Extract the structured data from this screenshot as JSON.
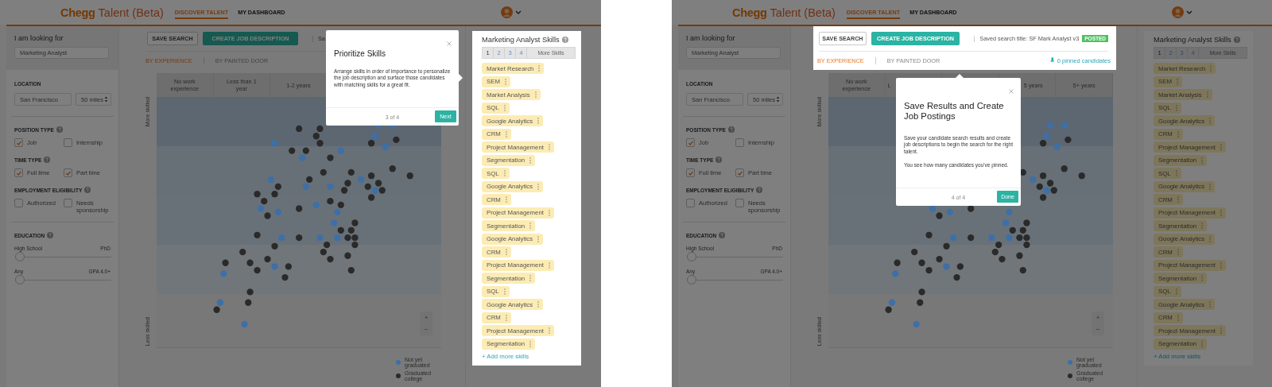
{
  "screens": [
    {
      "header": {
        "brand": "Chegg",
        "product": "Talent (Beta)",
        "nav": [
          {
            "label": "DISCOVER TALENT",
            "selected": true
          },
          {
            "label": "MY DASHBOARD",
            "selected": false
          }
        ]
      },
      "sidebar": {
        "looking_for": {
          "label": "I am looking for",
          "value": "Marketing Analyst"
        },
        "location": {
          "label": "LOCATION",
          "city": "San Francisco",
          "distance": "50 miles"
        },
        "filters": [
          {
            "label": "POSITION TYPE",
            "options": [
              {
                "label": "Job",
                "checked": true
              },
              {
                "label": "Internship",
                "checked": false
              }
            ]
          },
          {
            "label": "TIME TYPE",
            "options": [
              {
                "label": "Full time",
                "checked": true
              },
              {
                "label": "Part time",
                "checked": true
              }
            ]
          },
          {
            "label": "EMPLOYMENT ELIGIBILITY",
            "options": [
              {
                "label": "Authorized",
                "checked": false
              },
              {
                "label": "Needs sponsorship",
                "checked": false
              }
            ]
          }
        ],
        "education": {
          "label": "EDUCATION",
          "sliders": [
            {
              "low": "High School",
              "high": "PhD",
              "level": 0
            },
            {
              "low": "Any",
              "high": "GPA 4.0+",
              "level": 0
            }
          ]
        }
      },
      "toolbar": {
        "highlighted": false,
        "buttons": [
          {
            "label": "SAVE SEARCH",
            "kind": "outline"
          },
          {
            "label": "CREATE JOB DESCRIPTION",
            "kind": "primary"
          }
        ],
        "saved_title": "Sa",
        "views": [
          {
            "label": "BY EXPERIENCE",
            "selected": true
          },
          {
            "label": "BY PAINTED DOOR",
            "selected": false
          }
        ]
      },
      "chart": {
        "columns": [
          {
            "label": "No work experience"
          },
          {
            "label": "Less than 1 year"
          },
          {
            "label": "1-2 years"
          },
          {},
          {}
        ],
        "y_top": "More skilled",
        "y_bottom": "Less skilled",
        "zoom": [
          "+",
          "−"
        ],
        "legend": [
          {
            "label": "Not yet graduated",
            "color": "#3d6fa8"
          },
          {
            "label": "Graduated college",
            "color": "#2a2a2a"
          }
        ]
      },
      "skills": {
        "highlighted": true,
        "title": "Marketing Analyst Skills",
        "tabs": [
          {
            "label": "1",
            "selected": true
          },
          {
            "label": "2",
            "selected": false
          },
          {
            "label": "3",
            "selected": false
          },
          {
            "label": "4",
            "selected": false
          },
          {
            "label": "More Skills",
            "selected": false
          }
        ],
        "items": [
          "Market Research",
          "SEM",
          "Market Analysis",
          "SQL",
          "Google Analytics",
          "CRM",
          "Project Management",
          "Segmentation",
          "SQL",
          "Google Analytics",
          "CRM",
          "Project Management",
          "Segmentation",
          "Google Analytics",
          "CRM",
          "Project Management",
          "Segmentation",
          "SQL",
          "Google Analytics",
          "CRM",
          "Project Management",
          "Segmentation"
        ],
        "add": "+ Add more skills"
      },
      "tour": {
        "title": "Prioritize Skills",
        "body": [
          "Arrange skills in order of importance to personalize the job description and surface those candidates with matching skills for a great fit."
        ],
        "step": "3 of 4",
        "button": "Next"
      }
    },
    {
      "header": {
        "brand": "Chegg",
        "product": "Talent (Beta)",
        "nav": [
          {
            "label": "DISCOVER TALENT",
            "selected": true
          },
          {
            "label": "MY DASHBOARD",
            "selected": false
          }
        ]
      },
      "sidebar": {
        "looking_for": {
          "label": "I am looking for",
          "value": "Marketing Analyst"
        },
        "location": {
          "label": "LOCATION",
          "city": "San Francisco",
          "distance": "50 miles"
        },
        "filters": [
          {
            "label": "POSITION TYPE",
            "options": [
              {
                "label": "Job",
                "checked": true
              },
              {
                "label": "Internship",
                "checked": false
              }
            ]
          },
          {
            "label": "TIME TYPE",
            "options": [
              {
                "label": "Full time",
                "checked": true
              },
              {
                "label": "Part time",
                "checked": true
              }
            ]
          },
          {
            "label": "EMPLOYMENT ELIGIBILITY",
            "options": [
              {
                "label": "Authorized",
                "checked": false
              },
              {
                "label": "Needs sponsorship",
                "checked": false
              }
            ]
          }
        ],
        "education": {
          "label": "EDUCATION",
          "sliders": [
            {
              "low": "High School",
              "high": "PhD",
              "level": 0
            },
            {
              "low": "Any",
              "high": "GPA 4.0+",
              "level": 0
            }
          ]
        }
      },
      "toolbar": {
        "highlighted": true,
        "buttons": [
          {
            "label": "SAVE SEARCH",
            "kind": "outline"
          },
          {
            "label": "CREATE JOB DESCRIPTION",
            "kind": "primary"
          }
        ],
        "saved_title": "Saved search title: SF Mark Analyst v3",
        "badge": "POSTED",
        "views": [
          {
            "label": "BY EXPERIENCE",
            "selected": true
          },
          {
            "label": "BY PAINTED DOOR",
            "selected": false
          }
        ],
        "pinned": "0 pinned candidates"
      },
      "chart": {
        "columns": [
          {
            "label": "No work experience"
          },
          {
            "label": "L"
          },
          {},
          {
            "label": "5 years"
          },
          {
            "label": "5+ years"
          }
        ],
        "y_top": "More skilled",
        "y_bottom": "Less skilled",
        "zoom": [
          "+",
          "−"
        ],
        "legend": [
          {
            "label": "Not yet graduated",
            "color": "#3d6fa8"
          },
          {
            "label": "Graduated college",
            "color": "#2a2a2a"
          }
        ]
      },
      "skills": {
        "highlighted": false,
        "title": "Marketing Analyst Skills",
        "tabs": [
          {
            "label": "1",
            "selected": true
          },
          {
            "label": "2",
            "selected": false
          },
          {
            "label": "3",
            "selected": false
          },
          {
            "label": "4",
            "selected": false
          },
          {
            "label": "More Skills",
            "selected": false
          }
        ],
        "items": [
          "Market Research",
          "SEM",
          "Market Analysis",
          "SQL",
          "Google Analytics",
          "CRM",
          "Project Management",
          "Segmentation",
          "SQL",
          "Google Analytics",
          "CRM",
          "Project Management",
          "Segmentation",
          "Google Analytics",
          "CRM",
          "Project Management",
          "Segmentation",
          "SQL",
          "Google Analytics",
          "CRM",
          "Project Management",
          "Segmentation"
        ],
        "add": "+ Add more skills"
      },
      "tour": {
        "title": "Save Results and Create Job Postings",
        "body": [
          "Save your candidate search results and create job descriptions to begin the search for the right talent.",
          "You see how many candidates you've pinned."
        ],
        "step": "4 of 4",
        "button": "Done"
      }
    }
  ]
}
